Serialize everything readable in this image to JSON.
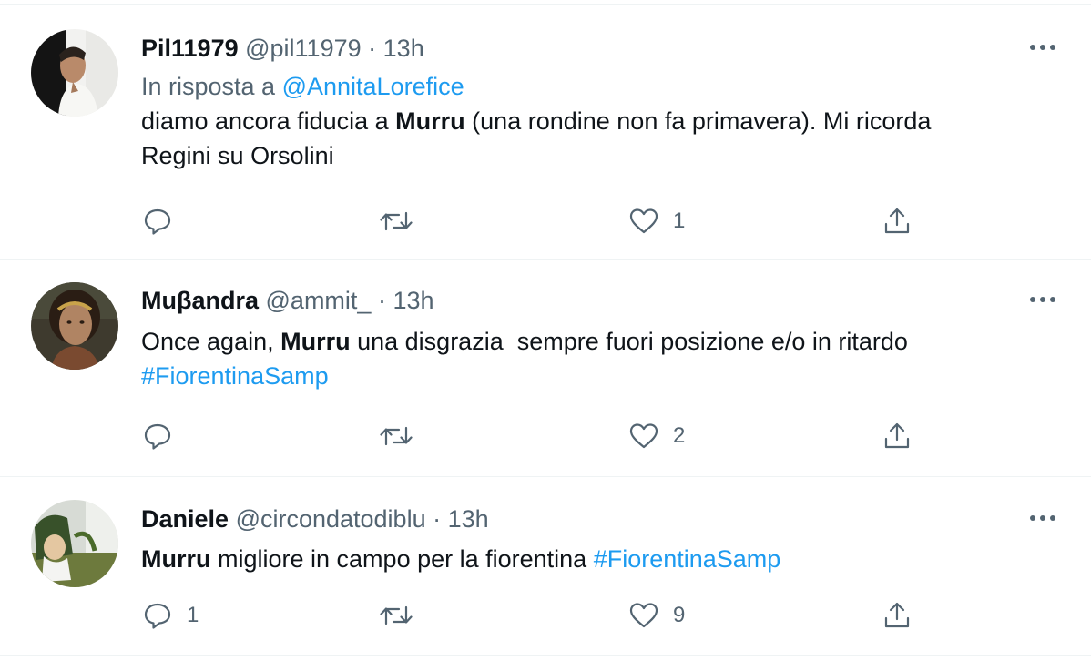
{
  "tweets": [
    {
      "name": "Pil11979",
      "handle": "@pil11979",
      "separator": "·",
      "time": "13h",
      "reply_prefix": "In risposta a",
      "reply_handle": "@AnnitaLorefice",
      "text_parts": [
        "diamo ancora fiducia a ",
        "Murru",
        " (una rondine non fa primavera). Mi ricorda",
        "Regini su Orsolini"
      ],
      "reply_count": "",
      "retweet_count": "",
      "like_count": "1"
    },
    {
      "name": "Muβandra",
      "handle": "@ammit_",
      "separator": "·",
      "time": "13h",
      "text_parts": [
        "Once again, ",
        "Murru",
        " una disgrazia  sempre fuori posizione e/o in ritardo",
        "#FiorentinaSamp"
      ],
      "reply_count": "",
      "retweet_count": "",
      "like_count": "2"
    },
    {
      "name": "Daniele",
      "handle": "@circondatodiblu",
      "separator": "·",
      "time": "13h",
      "text_parts": [
        "Murru",
        " migliore in campo per la fiorentina ",
        "#FiorentinaSamp"
      ],
      "reply_count": "1",
      "retweet_count": "",
      "like_count": "9"
    }
  ],
  "icons": {
    "more": "more-horizontal-icon",
    "reply": "reply-icon",
    "retweet": "retweet-icon",
    "like": "heart-icon",
    "share": "share-icon"
  },
  "colors": {
    "text": "#0f1419",
    "secondary": "#536471",
    "link": "#1d9bf0",
    "divider": "#eff3f4"
  }
}
